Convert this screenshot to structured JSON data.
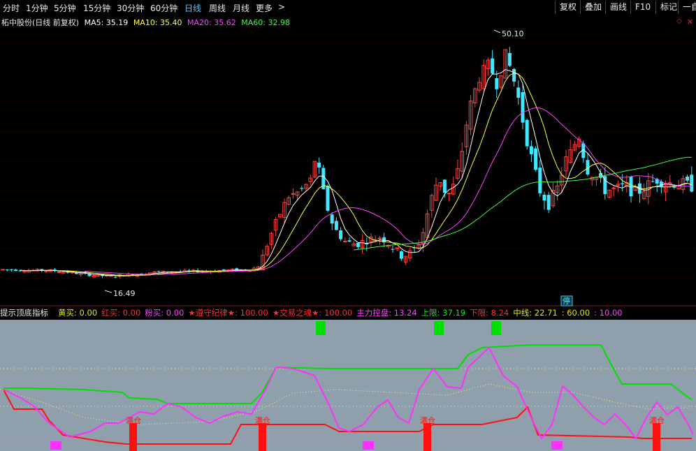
{
  "toolbar": {
    "tabs": [
      "分时",
      "1分钟",
      "5分钟",
      "15分钟",
      "30分钟",
      "60分钟",
      "日线",
      "周线",
      "月线",
      "更多"
    ],
    "active_tab": "日线",
    "more_arrow": ">",
    "right_buttons": [
      "复权",
      "叠加",
      "画线",
      "F10",
      "标记",
      "一自"
    ]
  },
  "legend": {
    "stock": "柘中股份(日线 前复权)",
    "ma5": "MA5: 35.19",
    "ma10": "MA10: 35.40",
    "ma20": "MA20: 35.62",
    "ma60": "MA60: 32.98"
  },
  "annotations": {
    "high": "50.10",
    "low": "16.49",
    "stop_badge": "停"
  },
  "indicator": {
    "name": "提示顶底指标",
    "items": [
      {
        "label": "黄买: 0.00",
        "color": "#e8e800"
      },
      {
        "label": "红买: 0.00",
        "color": "#ff3030"
      },
      {
        "label": "粉买: 0.00",
        "color": "#ff40ff"
      },
      {
        "label": "★遵守纪律★: 100.00",
        "color": "#ff3030"
      },
      {
        "label": "★交易之魂★: 100.00",
        "color": "#ff3030"
      },
      {
        "label": "主力控盘: 13.24",
        "color": "#ff40ff"
      },
      {
        "label": "上限: 37.19",
        "color": "#20e020"
      },
      {
        "label": "下限: 8.24",
        "color": "#ff3030"
      },
      {
        "label": "中线: 22.71",
        "color": "#e8e800"
      },
      {
        "label": ": 60.00",
        "color": "#e8e800"
      },
      {
        "label": ": 10.00",
        "color": "#ff40ff"
      }
    ],
    "full_position_label": "满仓",
    "colors": {
      "green": "#00e000",
      "red": "#ff1010",
      "magenta": "#ff30ff",
      "bg": "#8fa0ac"
    }
  },
  "colors": {
    "up": "#ff4040",
    "down": "#40e8ff",
    "ma5": "#ffffff",
    "ma10": "#ffff40",
    "ma20": "#ff40ff",
    "ma60": "#40ff40"
  }
}
